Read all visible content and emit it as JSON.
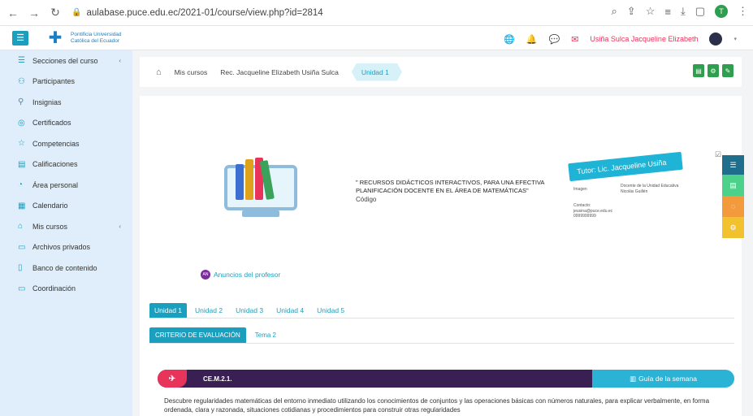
{
  "browser": {
    "url": "aulabase.puce.edu.ec/2021-01/course/view.php?id=2814",
    "profile_initial": "T"
  },
  "header": {
    "logo_line1": "Pontificia Universidad",
    "logo_line2": "Católica del Ecuador",
    "user_name": "Usiña Sulca Jacqueline Elizabeth"
  },
  "sidebar": {
    "items": [
      {
        "label": "Secciones del curso",
        "icon": "list-icon"
      },
      {
        "label": "Participantes",
        "icon": "users-icon"
      },
      {
        "label": "Insignias",
        "icon": "badge-icon"
      },
      {
        "label": "Certificados",
        "icon": "certificate-icon"
      },
      {
        "label": "Competencias",
        "icon": "star-icon"
      },
      {
        "label": "Calificaciones",
        "icon": "grades-icon"
      },
      {
        "label": "Área personal",
        "icon": "dashboard-icon"
      },
      {
        "label": "Calendario",
        "icon": "calendar-icon"
      },
      {
        "label": "Mis cursos",
        "icon": "graduation-cap-icon"
      },
      {
        "label": "Archivos privados",
        "icon": "file-icon"
      },
      {
        "label": "Banco de contenido",
        "icon": "content-bank-icon"
      },
      {
        "label": "Coordinación",
        "icon": "folder-icon"
      }
    ]
  },
  "breadcrumb": {
    "items": [
      "Mis cursos",
      "Rec. Jacqueline Elizabeth Usiña Sulca",
      "Unidad 1"
    ]
  },
  "course": {
    "title": "\" RECURSOS DIDÁCTICOS INTERACTIVOS, PARA UNA EFECTIVA PLANIFICACIÓN DOCENTE EN EL ÁREA DE MATEMÁTICAS\"",
    "code_label": "Código",
    "tutor_banner": "Tutor: Lic. Jacqueline Usiña",
    "tutor_text_left": "Imagen",
    "tutor_text_right": "Docente de la Unidad Educativa Nicolás Guillén",
    "tutor_contact": "Contacto: jeusina@puce.edu.ec 0999999999"
  },
  "announcements": {
    "badge": "AN",
    "label": "Anuncios del profesor"
  },
  "tabs_units": [
    "Unidad 1",
    "Unidad 2",
    "Unidad 3",
    "Unidad 4",
    "Unidad 5"
  ],
  "tabs_sub": [
    "CRITERIO DE EVALUACIÓN",
    "Tema 2"
  ],
  "criterion": {
    "code": "CE.M.2.1.",
    "guide_label": "Guía de la semana",
    "description": "Descubre regularidades matemáticas del entorno inmediato utilizando los conocimientos de conjuntos y las operaciones básicas con números naturales, para explicar verbalmente, en forma ordenada, clara y razonada, situaciones cotidianas y procedimientos para construir otras regularidades"
  },
  "colors": {
    "accent": "#1b9fbf",
    "sidebar_bg": "#dfeefa",
    "criterion_dark": "#3a1f52",
    "criterion_pin": "#e8335a",
    "guide_bg": "#2bb3d6",
    "edit_green": "#2e9e4f"
  }
}
